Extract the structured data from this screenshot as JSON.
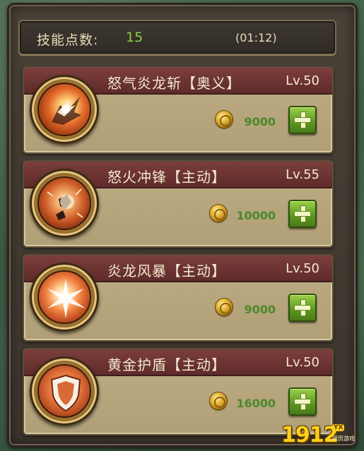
{
  "header": {
    "label": "技能点数:",
    "points": "15",
    "timer": "(01:12)"
  },
  "skills": [
    {
      "name": "怒气炎龙斩【奥义】",
      "level": "Lv.50",
      "cost": "9000",
      "icon": "dragon-slash-icon"
    },
    {
      "name": "怒火冲锋【主动】",
      "level": "Lv.55",
      "cost": "10000",
      "icon": "rage-charge-icon"
    },
    {
      "name": "炎龙风暴【主动】",
      "level": "Lv.50",
      "cost": "9000",
      "icon": "dragon-storm-icon"
    },
    {
      "name": "黄金护盾【主动】",
      "level": "Lv.50",
      "cost": "16000",
      "icon": "golden-shield-icon"
    }
  ],
  "watermark": {
    "logo": "1912",
    "tag": "YX",
    "sub": "网页游戏"
  },
  "colors": {
    "points_green": "#8cd33d",
    "cost_green": "#4a8a2a",
    "band_red": "#6b3334",
    "button_green": "#5f9a22"
  }
}
